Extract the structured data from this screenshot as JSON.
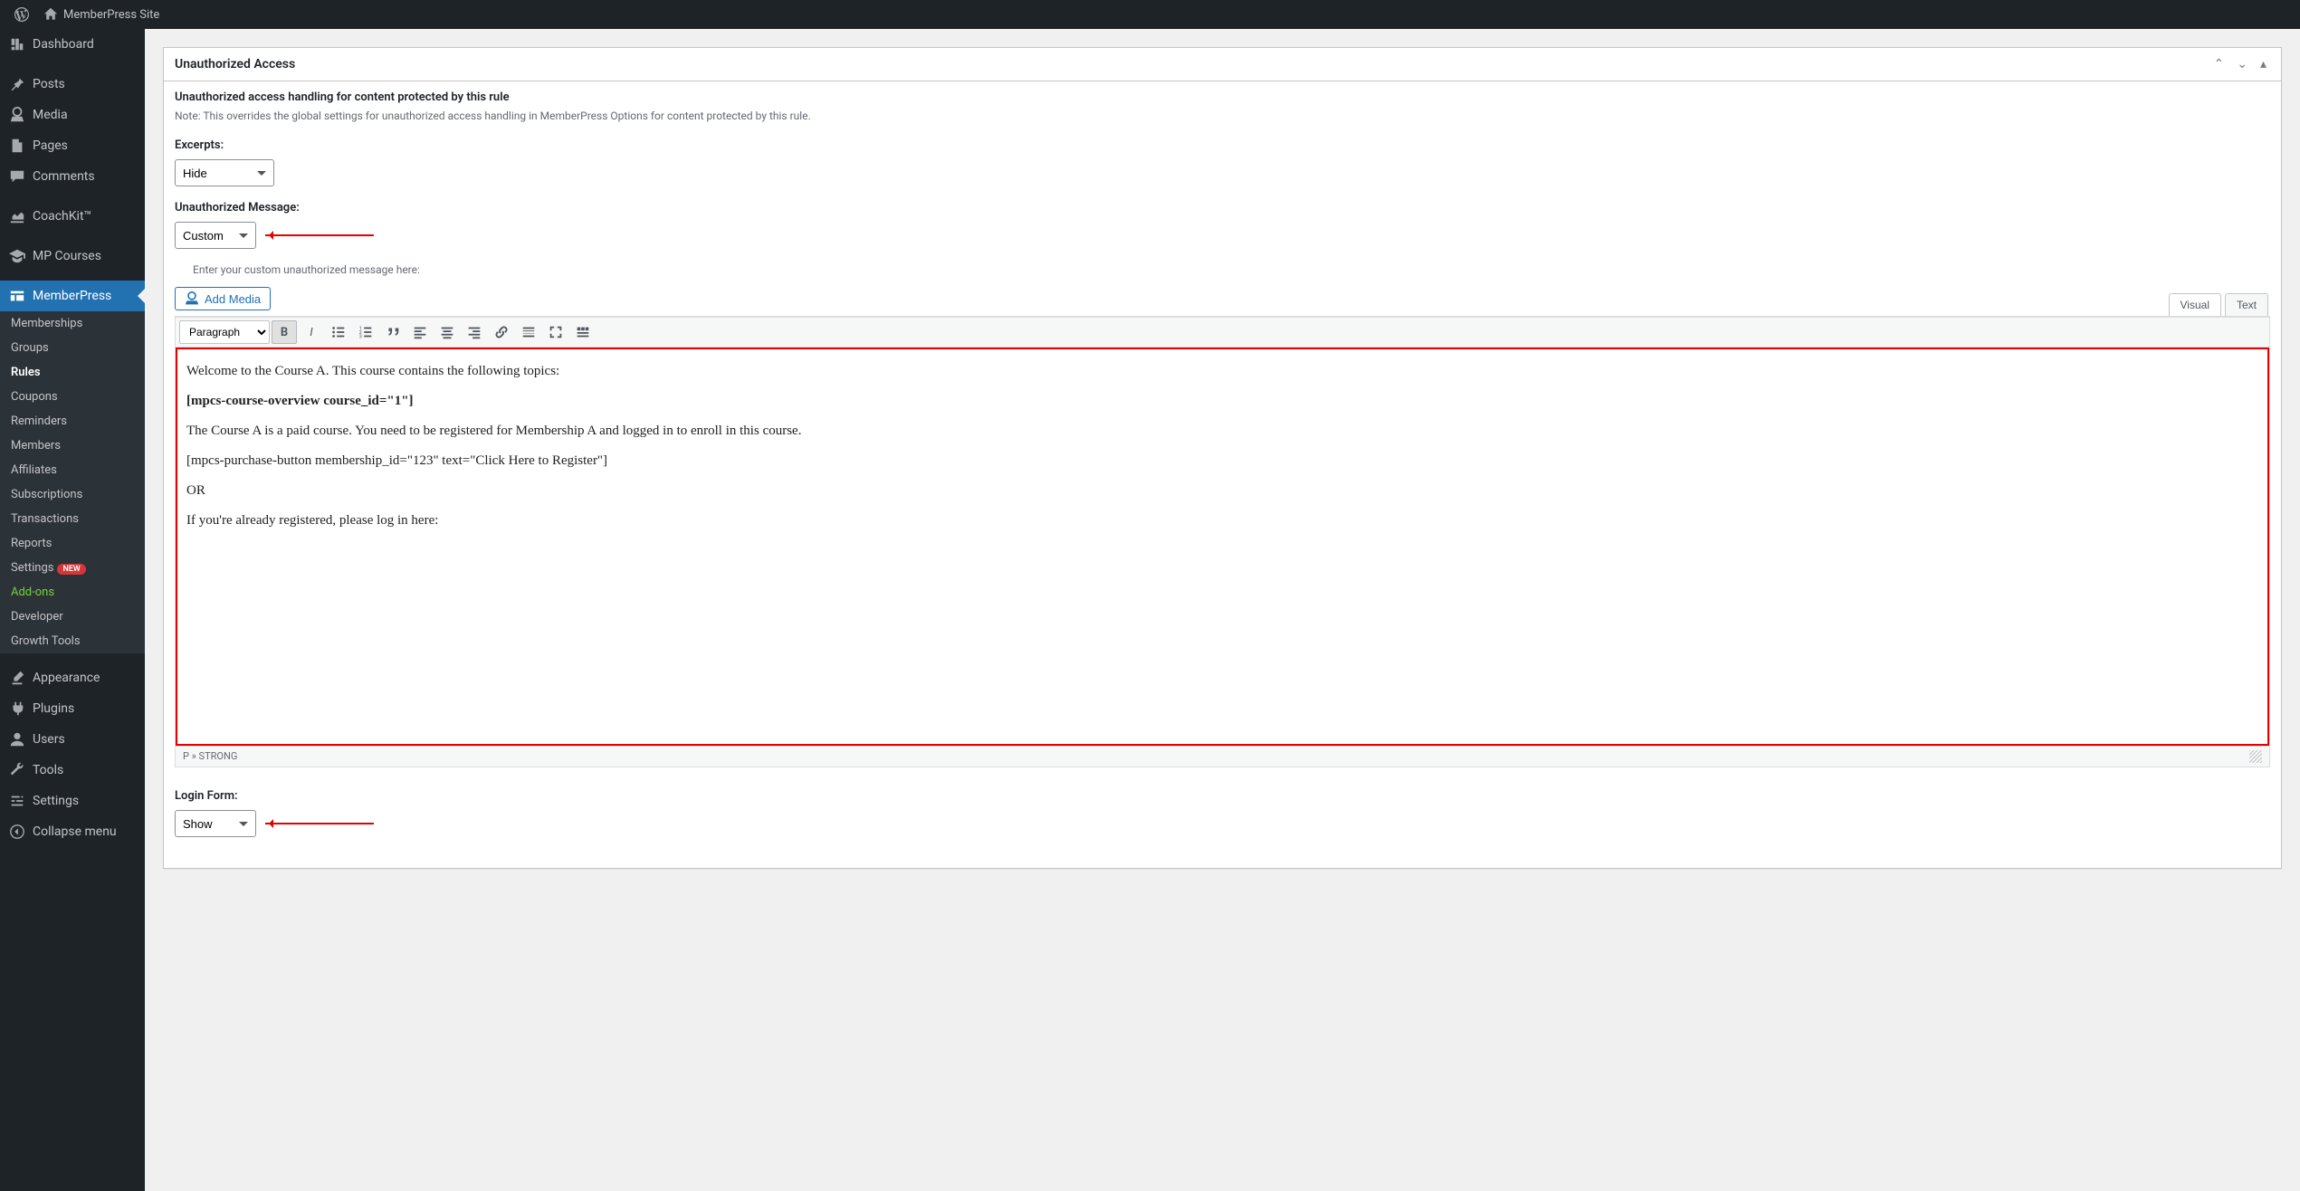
{
  "adminbar": {
    "site_name": "MemberPress Site"
  },
  "menu": {
    "dashboard": "Dashboard",
    "posts": "Posts",
    "media": "Media",
    "pages": "Pages",
    "comments": "Comments",
    "coachkit": "CoachKit™",
    "mp_courses": "MP Courses",
    "memberpress": "MemberPress",
    "appearance": "Appearance",
    "plugins": "Plugins",
    "users": "Users",
    "tools": "Tools",
    "settings": "Settings",
    "collapse": "Collapse menu"
  },
  "submenu": {
    "memberships": "Memberships",
    "groups": "Groups",
    "rules": "Rules",
    "coupons": "Coupons",
    "reminders": "Reminders",
    "members": "Members",
    "affiliates": "Affiliates",
    "subscriptions": "Subscriptions",
    "transactions": "Transactions",
    "reports": "Reports",
    "settings_sub": "Settings",
    "settings_badge": "NEW",
    "addons": "Add-ons",
    "developer": "Developer",
    "growth_tools": "Growth Tools"
  },
  "panel": {
    "title": "Unauthorized Access",
    "section_title": "Unauthorized access handling for content protected by this rule",
    "note": "Note: This overrides the global settings for unauthorized access handling in MemberPress Options for content protected by this rule.",
    "excerpts_label": "Excerpts:",
    "excerpts_value": "Hide",
    "unauth_msg_label": "Unauthorized Message:",
    "unauth_msg_value": "Custom",
    "hint": "Enter your custom unauthorized message here:",
    "login_form_label": "Login Form:",
    "login_form_value": "Show"
  },
  "editor": {
    "add_media": "Add Media",
    "tab_visual": "Visual",
    "tab_text": "Text",
    "format": "Paragraph",
    "status_path": "P » STRONG",
    "content": {
      "p1": "Welcome to the Course A. This course contains the following topics:",
      "p2": "[mpcs-course-overview course_id=\"1\"]",
      "p3": "The Course A is a paid course. You need to be registered for Membership A and logged in to enroll in this course.",
      "p4": "[mpcs-purchase-button membership_id=\"123\" text=\"Click Here to Register\"]",
      "p5": "OR",
      "p6": "If you're already registered, please log in here:"
    }
  }
}
